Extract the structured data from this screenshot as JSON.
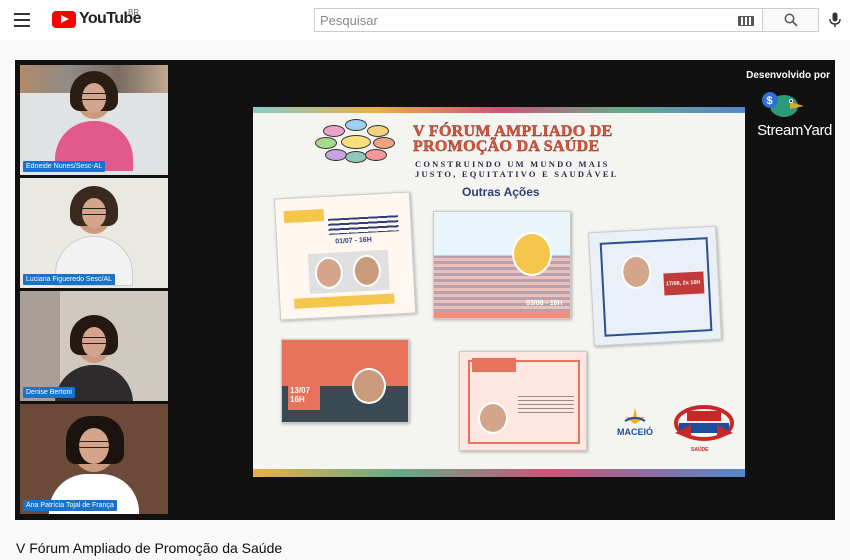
{
  "header": {
    "logo_text": "YouTube",
    "region": "BR",
    "search_placeholder": "Pesquisar",
    "icons": {
      "menu": "hamburger-menu-icon",
      "search": "search-icon",
      "mic": "microphone-icon",
      "keyboard": "keyboard-icon"
    }
  },
  "player": {
    "participants": [
      {
        "name": "Edneide Nunes/Sesc-AL"
      },
      {
        "name": "Luciana Figueredo Sesc/AL"
      },
      {
        "name": "Denise Bertoni"
      },
      {
        "name": "Ana Patrícia Tojal de França"
      }
    ],
    "watermark": {
      "developed_by": "Desenvolvido por",
      "brand": "StreamYard"
    },
    "slide": {
      "title_line1": "V FÓRUM AMPLIADO DE",
      "title_line2": "PROMOÇÃO DA SAÚDE",
      "subtitle_line1": "CONSTRUINDO UM MUNDO MAIS",
      "subtitle_line2": "JUSTO, EQUITATIVO E SAUDÁVEL",
      "section": "Outras Ações",
      "cards": [
        {
          "date": "01/07 - 16H"
        },
        {
          "date": "03/08 - 16H"
        },
        {
          "date": "17/08, 2x 16H"
        },
        {
          "date": "13/07 16H"
        },
        {
          "date": ""
        }
      ],
      "logos": {
        "maceio": "MACEIÓ",
        "sesc": "SAÚDE"
      }
    }
  },
  "video": {
    "title": "V Fórum Ampliado de Promoção da Saúde"
  },
  "colors": {
    "brand_red": "#ff0000",
    "tag_blue": "#1a73c8",
    "slide_title": "#d9573e",
    "slide_section": "#2d3f79"
  }
}
